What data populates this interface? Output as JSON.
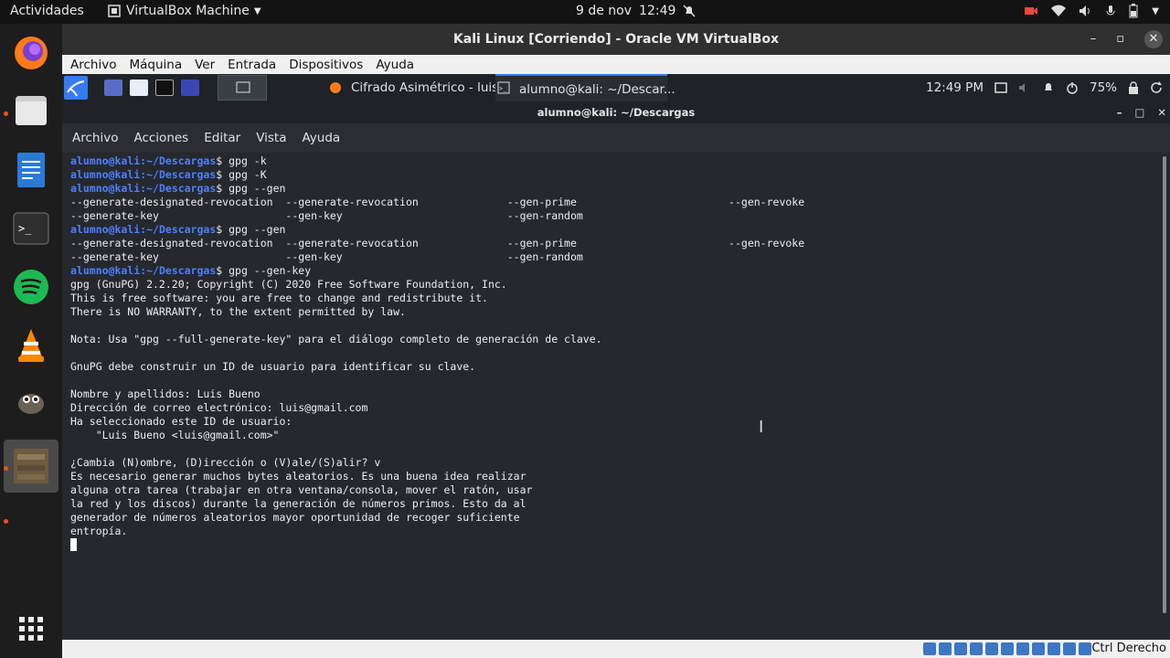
{
  "topbar": {
    "activities": "Actividades",
    "app_name": "VirtualBox Machine",
    "date": "9 de nov",
    "time": "12:49"
  },
  "vbox": {
    "window_title": "Kali Linux [Corriendo] - Oracle VM VirtualBox",
    "menu": [
      "Archivo",
      "Máquina",
      "Ver",
      "Entrada",
      "Dispositivos",
      "Ayuda"
    ],
    "host_key": "Ctrl Derecho"
  },
  "guest_panel": {
    "tasks": [
      "Cifrado Asimétrico - luis...",
      "alumno@kali: ~/Descar..."
    ],
    "time": "12:49 PM",
    "battery": "75%"
  },
  "terminal": {
    "title": "alumno@kali: ~/Descargas",
    "menu": [
      "Archivo",
      "Acciones",
      "Editar",
      "Vista",
      "Ayuda"
    ],
    "prompt_user": "alumno@kali",
    "prompt_path": ":~/Descargas",
    "lines": [
      {
        "prompt": true,
        "cmd": "$ gpg -k"
      },
      {
        "prompt": true,
        "cmd": "$ gpg -K"
      },
      {
        "prompt": true,
        "cmd": "$ gpg --gen"
      },
      {
        "prompt": false,
        "text": "--generate-designated-revocation  --generate-revocation              --gen-prime                        --gen-revoke"
      },
      {
        "prompt": false,
        "text": "--generate-key                    --gen-key                          --gen-random"
      },
      {
        "prompt": true,
        "cmd": "$ gpg --gen"
      },
      {
        "prompt": false,
        "text": "--generate-designated-revocation  --generate-revocation              --gen-prime                        --gen-revoke"
      },
      {
        "prompt": false,
        "text": "--generate-key                    --gen-key                          --gen-random"
      },
      {
        "prompt": true,
        "cmd": "$ gpg --gen-key"
      },
      {
        "prompt": false,
        "text": "gpg (GnuPG) 2.2.20; Copyright (C) 2020 Free Software Foundation, Inc."
      },
      {
        "prompt": false,
        "text": "This is free software: you are free to change and redistribute it."
      },
      {
        "prompt": false,
        "text": "There is NO WARRANTY, to the extent permitted by law."
      },
      {
        "prompt": false,
        "text": ""
      },
      {
        "prompt": false,
        "text": "Nota: Usa \"gpg --full-generate-key\" para el diálogo completo de generación de clave."
      },
      {
        "prompt": false,
        "text": ""
      },
      {
        "prompt": false,
        "text": "GnuPG debe construir un ID de usuario para identificar su clave."
      },
      {
        "prompt": false,
        "text": ""
      },
      {
        "prompt": false,
        "text": "Nombre y apellidos: Luis Bueno"
      },
      {
        "prompt": false,
        "text": "Dirección de correo electrónico: luis@gmail.com"
      },
      {
        "prompt": false,
        "text": "Ha seleccionado este ID de usuario:"
      },
      {
        "prompt": false,
        "text": "    \"Luis Bueno <luis@gmail.com>\""
      },
      {
        "prompt": false,
        "text": ""
      },
      {
        "prompt": false,
        "text": "¿Cambia (N)ombre, (D)irección o (V)ale/(S)alir? v"
      },
      {
        "prompt": false,
        "text": "Es necesario generar muchos bytes aleatorios. Es una buena idea realizar"
      },
      {
        "prompt": false,
        "text": "alguna otra tarea (trabajar en otra ventana/consola, mover el ratón, usar"
      },
      {
        "prompt": false,
        "text": "la red y los discos) durante la generación de números primos. Esto da al"
      },
      {
        "prompt": false,
        "text": "generador de números aleatorios mayor oportunidad de recoger suficiente"
      },
      {
        "prompt": false,
        "text": "entropía."
      }
    ]
  }
}
